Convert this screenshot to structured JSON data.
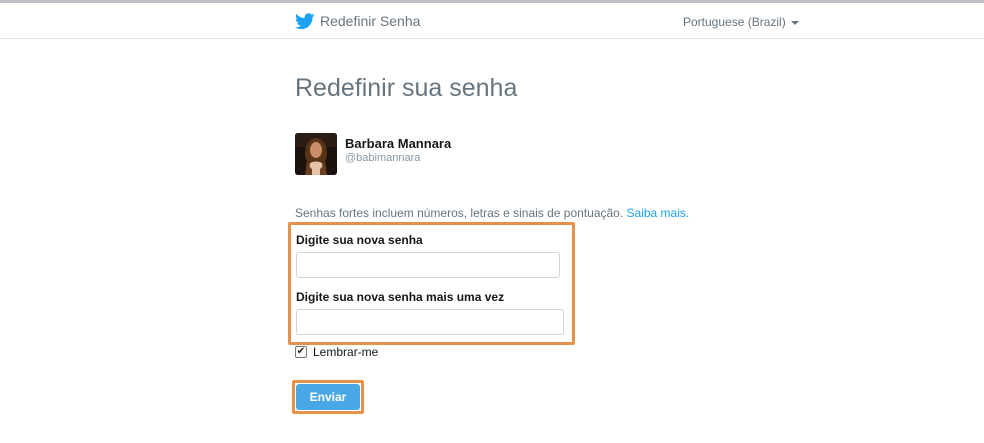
{
  "header": {
    "title": "Redefinir Senha",
    "language": "Portuguese (Brazil)",
    "brand_color": "#1da1f2"
  },
  "main": {
    "title": "Redefinir sua senha",
    "user": {
      "name": "Barbara Mannara",
      "handle": "@babimannara"
    },
    "hint": {
      "text": "Senhas fortes incluem números, letras e sinais de pontuação.",
      "link": "Saiba mais."
    },
    "fields": {
      "new_password_label": "Digite sua nova senha",
      "new_password_value": "",
      "confirm_password_label": "Digite sua nova senha mais uma vez",
      "confirm_password_value": ""
    },
    "remember": {
      "label": "Lembrar-me",
      "checked": true
    },
    "submit_label": "Enviar"
  },
  "colors": {
    "highlight": "#e8914a",
    "button": "#4aa7e6",
    "link": "#1da1f2"
  }
}
